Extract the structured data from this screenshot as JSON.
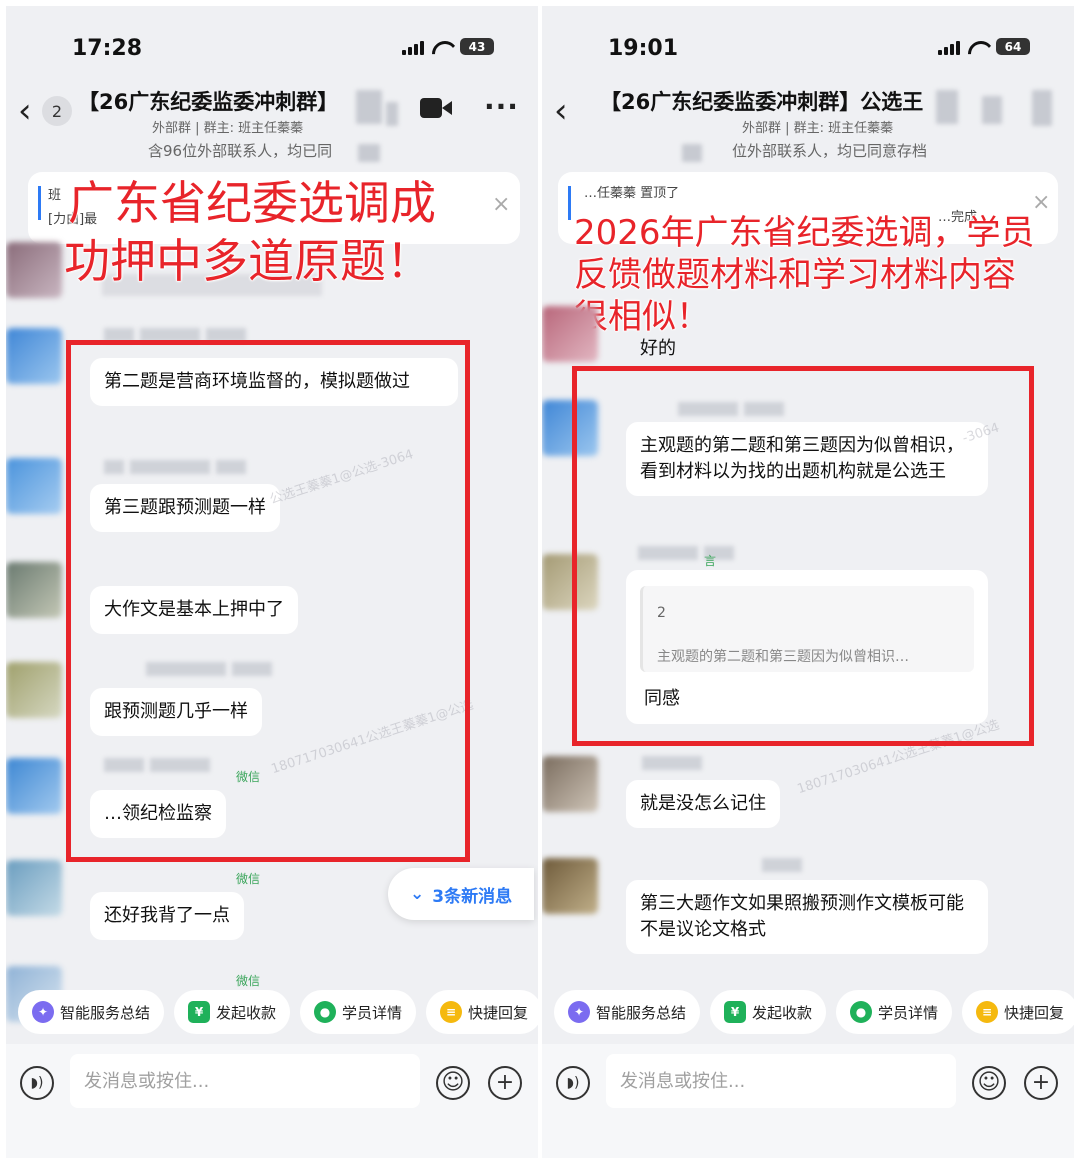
{
  "left": {
    "status_time": "17:28",
    "battery": "43",
    "unread_count": "2",
    "title": "【26广东纪委监委冲刺群】",
    "subtitle_group": "外部群 | 群主: 班主任蓁蓁",
    "subtitle_members": "含96位外部联系人，均已同",
    "notice_text1": "班",
    "notice_text2": "[力由]最",
    "overlay": [
      "广东省纪委选调成",
      "功押中多道原题！"
    ],
    "messages": [
      "第二题是营商环境监督的，模拟题做过",
      "第三题跟预测题一样",
      "大作文是基本上押中了",
      "跟预测题几乎一样",
      "…领纪检监察",
      "还好我背了一点"
    ],
    "tags": [
      "微信",
      "微信",
      "微信"
    ],
    "new_messages": "3条新消息"
  },
  "right": {
    "status_time": "19:01",
    "battery": "64",
    "title": "【26广东纪委监委冲刺群】公选王",
    "subtitle_group": "外部群 | 群主: 班主任蓁蓁",
    "subtitle_members": "位外部联系人，均已同意存档",
    "notice_text1": "…任蓁蓁 置顶了",
    "notice_text2": "…完成",
    "overlay": [
      "2026年广东省纪委选调，学员",
      "反馈做题材料和学习材料内容",
      "很相似！"
    ],
    "reply_ok": "好的",
    "messages": [
      "主观题的第二题和第三题因为似曾相识，看到材料以为找的出题机构就是公选王",
      "同感",
      "就是没怎么记住",
      "第三大题作文如果照搬预测作文模板可能不是议论文格式"
    ],
    "quote_number": "2",
    "quote_text": "主观题的第二题和第三题因为似曾相识…",
    "tag": "言"
  },
  "toolbar": {
    "summary": "智能服务总结",
    "payment": "发起收款",
    "student": "学员详情",
    "quick_reply": "快捷回复"
  },
  "input": {
    "placeholder": "发消息或按住..."
  },
  "colors": {
    "overlay_red": "#e8242a",
    "link_blue": "#2d7af5",
    "tag_green": "#3aa55a"
  }
}
